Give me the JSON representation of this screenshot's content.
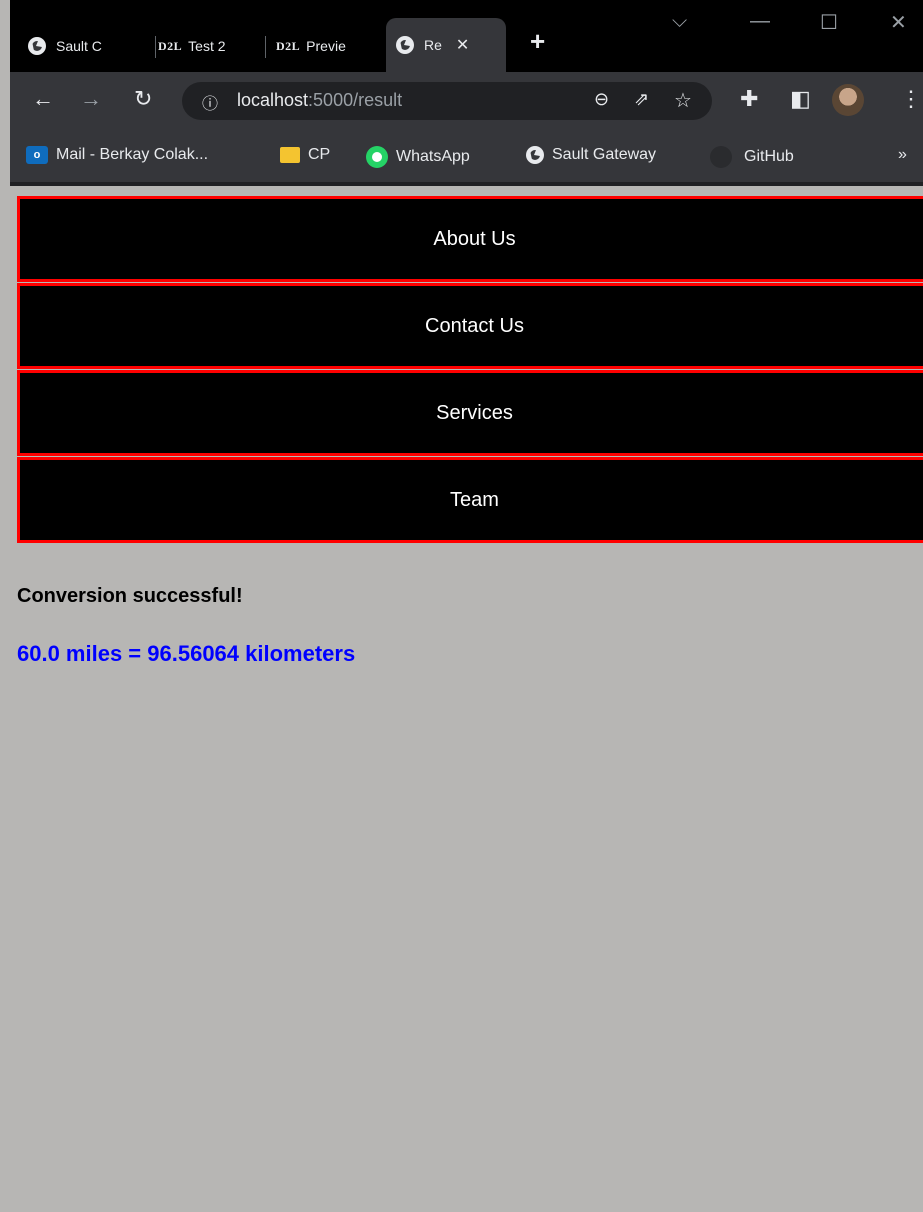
{
  "browser": {
    "tabs": [
      {
        "label": "Sault C",
        "icon": "globe-icon"
      },
      {
        "label": "Test 2",
        "icon": "d2l-icon"
      },
      {
        "label": "Previe",
        "icon": "d2l-icon"
      },
      {
        "label": "Re",
        "icon": "globe-icon",
        "active": true
      }
    ],
    "d2l_logo": "D2L",
    "new_tab": "+",
    "close_tab": "✕",
    "url_host": "localhost",
    "url_path": ":5000/result",
    "bookmarks": [
      {
        "label": "Mail - Berkay Colak...",
        "icon": "outlook-icon"
      },
      {
        "label": "CP",
        "icon": "folder-icon"
      },
      {
        "label": "WhatsApp",
        "icon": "whatsapp-icon"
      },
      {
        "label": "Sault Gateway",
        "icon": "globe-icon"
      },
      {
        "label": "GitHub",
        "icon": "github-icon"
      }
    ],
    "more_bookmarks": "»"
  },
  "page": {
    "nav": [
      "About Us",
      "Contact Us",
      "Services",
      "Team"
    ],
    "message": "Conversion successful!",
    "result": "60.0 miles = 96.56064 kilometers"
  },
  "colors": {
    "nav_border": "#ff0000",
    "result_text": "#0000ff",
    "page_bg": "#b7b6b4"
  }
}
